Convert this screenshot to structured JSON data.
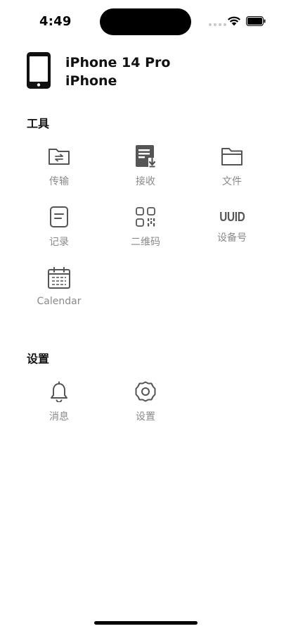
{
  "status_bar": {
    "time": "4:49"
  },
  "device": {
    "name": "iPhone 14 Pro",
    "model": "iPhone"
  },
  "tools": {
    "title": "工具",
    "items": [
      {
        "label": "传输",
        "icon": "folder-transfer-icon"
      },
      {
        "label": "接收",
        "icon": "receive-document-icon"
      },
      {
        "label": "文件",
        "icon": "folder-icon"
      },
      {
        "label": "记录",
        "icon": "note-icon"
      },
      {
        "label": "二维码",
        "icon": "qr-code-icon"
      },
      {
        "label": "设备号",
        "icon": "uuid-icon",
        "icon_text": "UUID"
      },
      {
        "label": "Calendar",
        "icon": "calendar-icon"
      }
    ]
  },
  "settings": {
    "title": "设置",
    "items": [
      {
        "label": "消息",
        "icon": "bell-icon"
      },
      {
        "label": "设置",
        "icon": "gear-icon"
      }
    ]
  },
  "colors": {
    "icon_gray": "#555555",
    "label_gray": "#8a8a8a"
  }
}
